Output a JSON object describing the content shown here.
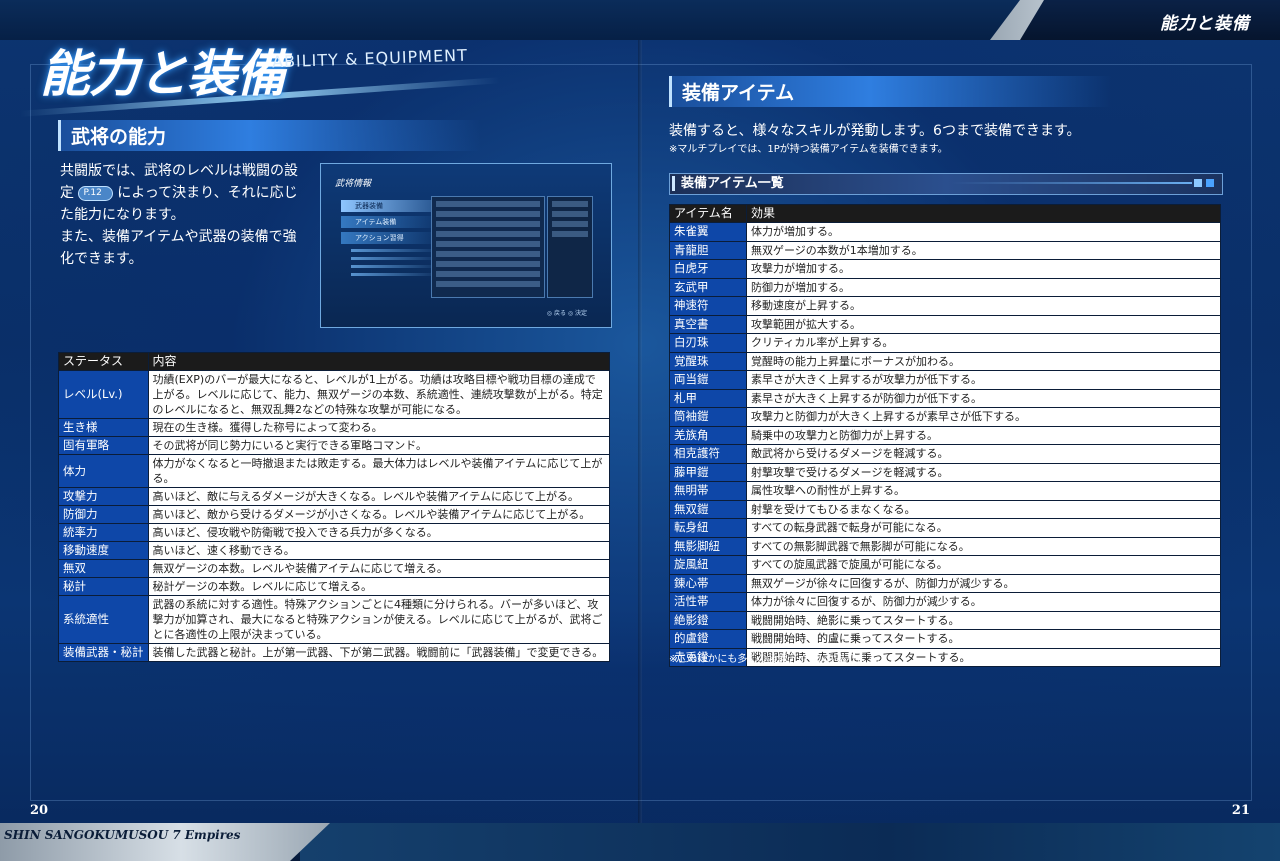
{
  "header": {
    "right_title": "能力と装備"
  },
  "footer": {
    "game_title": "SHIN SANGOKUMUSOU 7 Empires",
    "page_left": "20",
    "page_right": "21"
  },
  "main_title": {
    "jp": "能力と装備",
    "en": "ABILITY & EQUIPMENT"
  },
  "left": {
    "section_title": "武将の能力",
    "intro_before_pill": "共闘版では、武将のレベルは戦闘の設定",
    "pill": "P.12",
    "intro_after_pill": "によって決まり、それに応じた能力になります。",
    "intro_line2": "また、装備アイテムや武器の装備で強化できます。",
    "screenshot": {
      "title": "武将情報",
      "menu": [
        "武器装備",
        "アイテム装備",
        "アクション習得"
      ],
      "foot": "◎ 戻る ◎ 決定"
    },
    "table": {
      "headers": [
        "ステータス",
        "内容"
      ],
      "rows": [
        [
          "レベル(Lv.)",
          "功績(EXP)のバーが最大になると、レベルが1上がる。功績は攻略目標や戦功目標の達成で上がる。レベルに応じて、能力、無双ゲージの本数、系統適性、連続攻撃数が上がる。特定のレベルになると、無双乱舞2などの特殊な攻撃が可能になる。"
        ],
        [
          "生き様",
          "現在の生き様。獲得した称号によって変わる。"
        ],
        [
          "固有軍略",
          "その武将が同じ勢力にいると実行できる軍略コマンド。"
        ],
        [
          "体力",
          "体力がなくなると一時撤退または敗走する。最大体力はレベルや装備アイテムに応じて上がる。"
        ],
        [
          "攻撃力",
          "高いほど、敵に与えるダメージが大きくなる。レベルや装備アイテムに応じて上がる。"
        ],
        [
          "防御力",
          "高いほど、敵から受けるダメージが小さくなる。レベルや装備アイテムに応じて上がる。"
        ],
        [
          "統率力",
          "高いほど、侵攻戦や防衛戦で投入できる兵力が多くなる。"
        ],
        [
          "移動速度",
          "高いほど、速く移動できる。"
        ],
        [
          "無双",
          "無双ゲージの本数。レベルや装備アイテムに応じて増える。"
        ],
        [
          "秘計",
          "秘計ゲージの本数。レベルに応じて増える。"
        ],
        [
          "系統適性",
          "武器の系統に対する適性。特殊アクションごとに4種類に分けられる。バーが多いほど、攻撃力が加算され、最大になると特殊アクションが使える。レベルに応じて上がるが、武将ごとに各適性の上限が決まっている。"
        ],
        [
          "装備武器・秘計",
          "装備した武器と秘計。上が第一武器、下が第二武器。戦闘前に「武器装備」で変更できる。"
        ]
      ]
    }
  },
  "right": {
    "section_title": "装備アイテム",
    "desc": "装備すると、様々なスキルが発動します。6つまで装備できます。",
    "note": "※マルチプレイでは、1Pが持つ装備アイテムを装備できます。",
    "list_title": "装備アイテム一覧",
    "table": {
      "headers": [
        "アイテム名",
        "効果"
      ],
      "rows": [
        [
          "朱雀翼",
          "体力が増加する。"
        ],
        [
          "青龍胆",
          "無双ゲージの本数が1本増加する。"
        ],
        [
          "白虎牙",
          "攻撃力が増加する。"
        ],
        [
          "玄武甲",
          "防御力が増加する。"
        ],
        [
          "神速符",
          "移動速度が上昇する。"
        ],
        [
          "真空書",
          "攻撃範囲が拡大する。"
        ],
        [
          "白刃珠",
          "クリティカル率が上昇する。"
        ],
        [
          "覚醒珠",
          "覚醒時の能力上昇量にボーナスが加わる。"
        ],
        [
          "両当鎧",
          "素早さが大きく上昇するが攻撃力が低下する。"
        ],
        [
          "札甲",
          "素早さが大きく上昇するが防御力が低下する。"
        ],
        [
          "筒袖鎧",
          "攻撃力と防御力が大きく上昇するが素早さが低下する。"
        ],
        [
          "羌族角",
          "騎乗中の攻撃力と防御力が上昇する。"
        ],
        [
          "相克護符",
          "敵武将から受けるダメージを軽減する。"
        ],
        [
          "藤甲鎧",
          "射撃攻撃で受けるダメージを軽減する。"
        ],
        [
          "無明帯",
          "属性攻撃への耐性が上昇する。"
        ],
        [
          "無双鎧",
          "射撃を受けてもひるまなくなる。"
        ],
        [
          "転身紐",
          "すべての転身武器で転身が可能になる。"
        ],
        [
          "無影脚紐",
          "すべての無影脚武器で無影脚が可能になる。"
        ],
        [
          "旋風紐",
          "すべての旋風武器で旋風が可能になる。"
        ],
        [
          "錬心帯",
          "無双ゲージが徐々に回復するが、防御力が減少する。"
        ],
        [
          "活性帯",
          "体力が徐々に回復するが、防御力が減少する。"
        ],
        [
          "絶影鐙",
          "戦闘開始時、絶影に乗ってスタートする。"
        ],
        [
          "的盧鐙",
          "戦闘開始時、的盧に乗ってスタートする。"
        ],
        [
          "赤兎鐙",
          "戦闘開始時、赤兎馬に乗ってスタートする。"
        ]
      ]
    },
    "bottom_note": "※このほかにも多くの装備アイテムがあります。"
  }
}
